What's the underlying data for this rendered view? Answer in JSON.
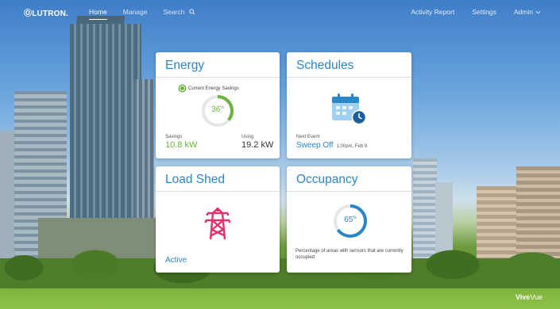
{
  "header": {
    "logo": "ⓄLUTRON.",
    "nav": [
      {
        "label": "Home",
        "active": true
      },
      {
        "label": "Manage",
        "active": false
      }
    ],
    "search_placeholder": "Search",
    "right_nav": [
      "Activity Report",
      "Settings",
      "Admin"
    ]
  },
  "cards": {
    "energy": {
      "title": "Energy",
      "legend": "Current Energy Savings",
      "percent": "36",
      "percent_unit": "%",
      "percent_value": 36,
      "savings_label": "Savings",
      "savings_value": "10.8 kW",
      "using_label": "Using",
      "using_value": "19.2 kW"
    },
    "schedules": {
      "title": "Schedules",
      "next_label": "Next Event",
      "next_event": "Sweep Off",
      "next_time": "1:00pm, Feb 9"
    },
    "load_shed": {
      "title": "Load Shed",
      "status": "Active"
    },
    "occupancy": {
      "title": "Occupancy",
      "percent": "65",
      "percent_unit": "%",
      "percent_value": 65,
      "description": "Percentage of areas with sensors that are currently occupied"
    }
  },
  "brand": {
    "part1": "Vive",
    "part2": "Vue"
  },
  "colors": {
    "accent_blue": "#2a86c6",
    "energy_green": "#6bb33a",
    "load_shed_pink": "#e2316f"
  }
}
